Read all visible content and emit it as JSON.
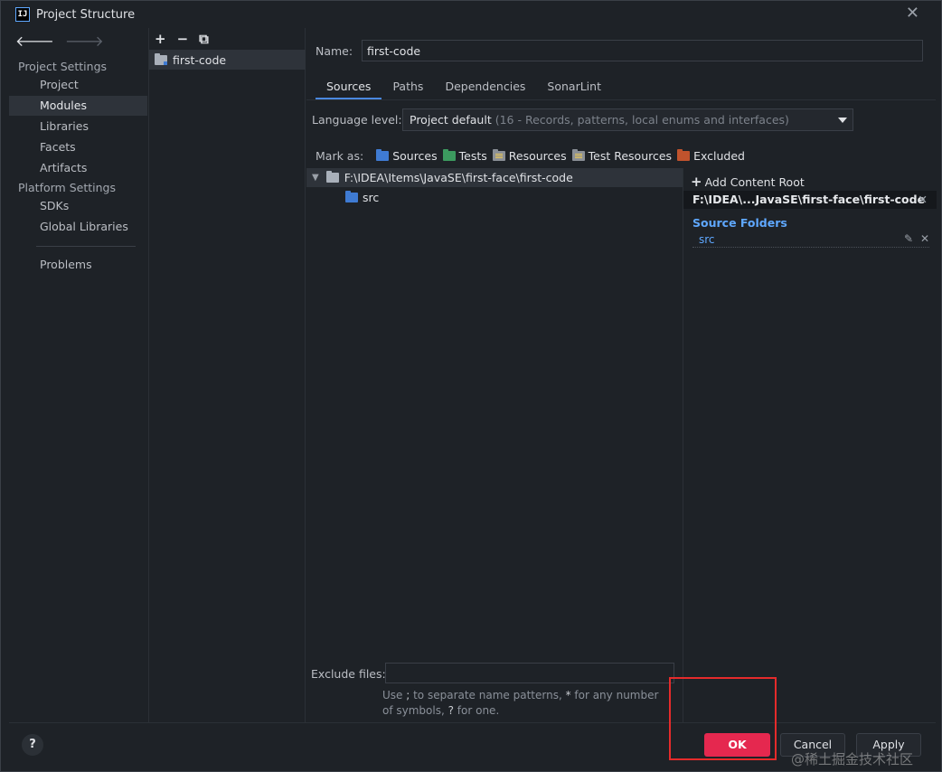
{
  "window": {
    "title": "Project Structure",
    "app_icon_text": "IJ",
    "close_glyph": "✕"
  },
  "nav": {
    "back_glyph": "🡐",
    "forward_glyph": "🡒",
    "project_settings_label": "Project Settings",
    "platform_settings_label": "Platform Settings",
    "items": [
      {
        "label": "Project"
      },
      {
        "label": "Modules"
      },
      {
        "label": "Libraries"
      },
      {
        "label": "Facets"
      },
      {
        "label": "Artifacts"
      },
      {
        "label": "SDKs"
      },
      {
        "label": "Global Libraries"
      },
      {
        "label": "Problems"
      }
    ]
  },
  "modules": {
    "add_glyph": "+",
    "remove_glyph": "−",
    "copy_glyph": "⧉",
    "list": [
      {
        "label": "first-code"
      }
    ]
  },
  "module": {
    "name_label": "Name:",
    "name_value": "first-code",
    "tabs": [
      {
        "label": "Sources"
      },
      {
        "label": "Paths"
      },
      {
        "label": "Dependencies"
      },
      {
        "label": "SonarLint"
      }
    ],
    "active_tab": "Sources",
    "language_level_label": "Language level:",
    "language_level_value": "Project default",
    "language_level_detail": "(16 - Records, patterns, local enums and interfaces)",
    "mark_as_label": "Mark as:",
    "mark_as": [
      {
        "label": "Sources",
        "icon": "sources-folder-icon"
      },
      {
        "label": "Tests",
        "icon": "tests-folder-icon"
      },
      {
        "label": "Resources",
        "icon": "resources-folder-icon"
      },
      {
        "label": "Test Resources",
        "icon": "test-resources-folder-icon"
      },
      {
        "label": "Excluded",
        "icon": "excluded-folder-icon"
      }
    ],
    "tree_root": "F:\\IDEA\\Items\\JavaSE\\first-face\\first-code",
    "tree_child": "src",
    "add_content_root": "Add Content Root",
    "content_root_path": "F:\\IDEA\\...JavaSE\\first-face\\first-code",
    "source_folders_heading": "Source Folders",
    "source_folders": [
      "src"
    ],
    "exclude_files_label": "Exclude files:",
    "exclude_files_value": "",
    "hint_part1": "Use ",
    "hint_sep": ";",
    "hint_part2": " to separate name patterns, ",
    "hint_star": "*",
    "hint_part3": " for any number of symbols, ",
    "hint_q": "?",
    "hint_part4": " for one."
  },
  "footer": {
    "help_label": "?",
    "ok_label": "OK",
    "cancel_label": "Cancel",
    "apply_label": "Apply",
    "watermark": "@稀土掘金技术社区"
  },
  "colors": {
    "accent": "#4a88e0",
    "ok_button": "#e5284f",
    "highlight_box": "#e52b2b",
    "link_blue": "#5fa8ff"
  }
}
